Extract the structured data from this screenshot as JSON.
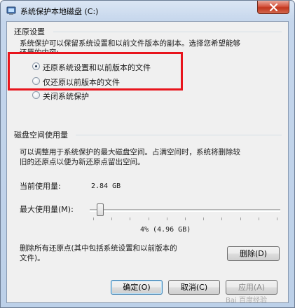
{
  "window": {
    "title": "系统保护本地磁盘 (C:)"
  },
  "restore_settings": {
    "group_title": "还原设置",
    "description_line1": "系统保护可以保留系统设置和以前文件版本的副本。选择您希望能够",
    "description_line2": "还原的内容:",
    "options": [
      {
        "label": "还原系统设置和以前版本的文件",
        "selected": true
      },
      {
        "label": "仅还原以前版本的文件",
        "selected": false
      },
      {
        "label": "关闭系统保护",
        "selected": false
      }
    ]
  },
  "disk_usage": {
    "group_title": "磁盘空间使用量",
    "description_line1": "可以调整用于系统保护的最大磁盘空间。占满空间时，系统将删除较",
    "description_line2": "旧的还原点以便为新还原点留出空间。",
    "current_label": "当前使用量:",
    "current_value": "2.84 GB",
    "max_label": "最大使用量(M):",
    "slider_value_percent": 4,
    "max_value_text": "4% (4.96 GB)",
    "delete_text_line1": "删除所有还原点(其中包括系统设置和以前版本的",
    "delete_text_line2": "文件)。",
    "delete_button": "删除(D)"
  },
  "footer": {
    "ok_button": "确定(O)",
    "cancel_button": "取消(C)",
    "apply_button": "应用(A)"
  },
  "watermark": "Bai 百度经验",
  "colors": {
    "highlight_border": "#e8141c",
    "close_button": "#c2361d",
    "title_bar": "#c5d6ec"
  }
}
